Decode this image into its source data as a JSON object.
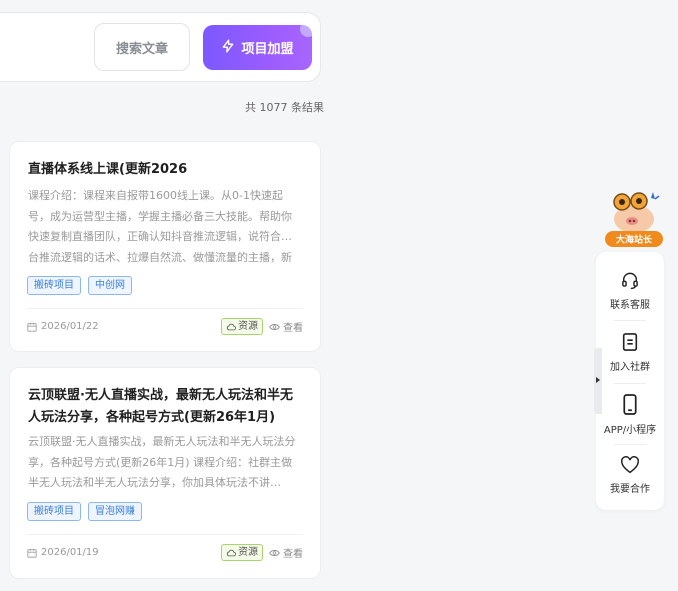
{
  "search": {
    "button_label": "搜索文章",
    "join_label": "项目加盟"
  },
  "results": {
    "count_text": "共 1077 条结果"
  },
  "articles": [
    {
      "title": "直播体系线上课(更新2026",
      "desc": "课程介绍：课程来自报带1600线上课。从0-1快速起号，成为运营型主播，学握主播必备三大技能。帮助你快速复制直播团队，正确认知抖音推流逻辑，说符合…台推流逻辑的话术、拉爆自然流、做懂流量的主播，新",
      "tags": [
        "搬砖项目",
        "中创网"
      ],
      "date": "2026/01/22",
      "badge": "资源",
      "view": "查看"
    },
    {
      "title": "云顶联盟·无人直播实战，最新无人玩法和半无人玩法分享，各种起号方式(更新26年1月)",
      "desc": "云顶联盟·无人直播实战，最新无人玩法和半无人玩法分享，各种起号方式(更新26年1月) 课程介绍：社群主做半无人玩法和半无人玩法分享，你加具体玩法不讲…",
      "tags": [
        "搬砖项目",
        "冒泡网赚"
      ],
      "date": "2026/01/19",
      "badge": "资源",
      "view": "查看"
    }
  ],
  "sidebar": {
    "mascot_label": "大海站长",
    "items": [
      {
        "label": "联系客服",
        "icon": "headset-icon"
      },
      {
        "label": "加入社群",
        "icon": "note-icon"
      },
      {
        "label": "APP/小程序",
        "icon": "phone-icon"
      },
      {
        "label": "我要合作",
        "icon": "heart-icon"
      }
    ]
  },
  "colors": {
    "accent_gradient_start": "#7b59ff",
    "accent_gradient_end": "#a866ff",
    "tag_blue": "#3d7fd9",
    "badge_green": "#a7d46c",
    "mascot_orange": "#f08a1c"
  }
}
